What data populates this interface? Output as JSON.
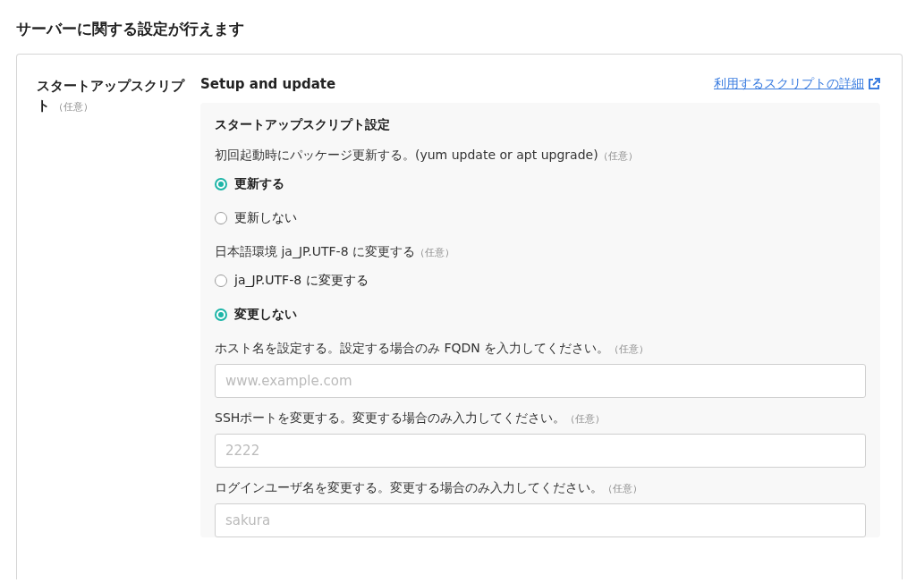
{
  "heading": "サーバーに関する設定が行えます",
  "section": {
    "label": "スタートアップスクリプト",
    "label_note": "（任意）",
    "title": "Setup and update",
    "link": "利用するスクリプトの詳細",
    "panel": {
      "title": "スタートアップスクリプト設定",
      "groups": [
        {
          "kind": "radio",
          "label": "初回起動時にパッケージ更新する。(yum update or apt upgrade)",
          "note": "（任意）",
          "options": [
            {
              "label": "更新する",
              "selected": true
            },
            {
              "label": "更新しない",
              "selected": false
            }
          ]
        },
        {
          "kind": "radio",
          "label": "日本語環境 ja_JP.UTF-8 に変更する",
          "note": "（任意）",
          "options": [
            {
              "label": "ja_JP.UTF-8 に変更する",
              "selected": false
            },
            {
              "label": "変更しない",
              "selected": true
            }
          ]
        },
        {
          "kind": "text",
          "label": "ホスト名を設定する。設定する場合のみ FQDN を入力してください。",
          "note": "（任意）",
          "placeholder": "www.example.com"
        },
        {
          "kind": "text",
          "label": "SSHポートを変更する。変更する場合のみ入力してください。",
          "note": "（任意）",
          "placeholder": "2222"
        },
        {
          "kind": "text",
          "label": "ログインユーザ名を変更する。変更する場合のみ入力してください。",
          "note": "（任意）",
          "placeholder": "sakura"
        }
      ]
    }
  }
}
